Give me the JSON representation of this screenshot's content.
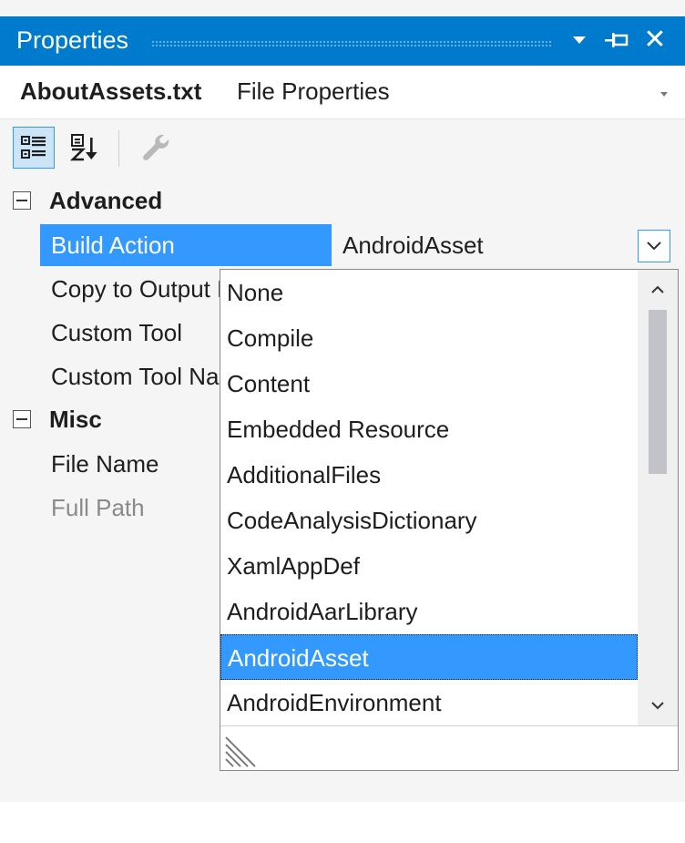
{
  "window": {
    "title": "Properties",
    "accent_color": "#007acc",
    "selection_color": "#3399ff",
    "icons": [
      "chevron-down-icon",
      "pin-icon",
      "close-icon"
    ],
    "close_glyph": "✕"
  },
  "selector": {
    "object_name": "AboutAssets.txt",
    "object_type": "File Properties"
  },
  "toolbar": {
    "buttons": [
      "categorized-icon",
      "alphabetical-icon",
      "property-pages-icon"
    ]
  },
  "grid": {
    "categories": [
      {
        "label": "Advanced",
        "properties": [
          {
            "name": "Build Action",
            "value": "AndroidAsset",
            "selected": true
          },
          {
            "name": "Copy to Output Directory",
            "value": ""
          },
          {
            "name": "Custom Tool",
            "value": ""
          },
          {
            "name": "Custom Tool Namespace",
            "value": ""
          }
        ]
      },
      {
        "label": "Misc",
        "properties": [
          {
            "name": "File Name",
            "value": ""
          },
          {
            "name": "Full Path",
            "value": "",
            "disabled": true
          }
        ]
      }
    ]
  },
  "dropdown": {
    "selected": "AndroidAsset",
    "items": [
      "None",
      "Compile",
      "Content",
      "Embedded Resource",
      "AdditionalFiles",
      "CodeAnalysisDictionary",
      "XamlAppDef",
      "AndroidAarLibrary",
      "AndroidAsset",
      "AndroidEnvironment"
    ]
  }
}
